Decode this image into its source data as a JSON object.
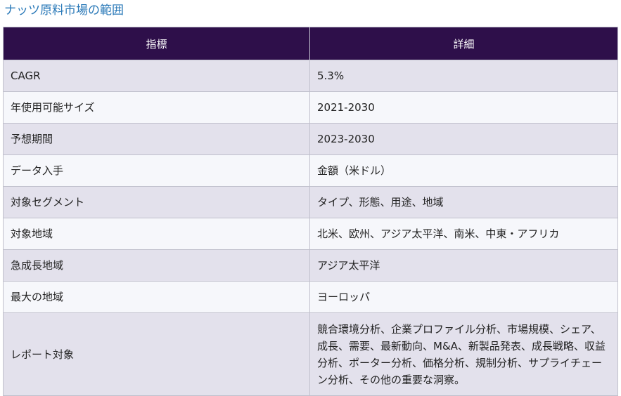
{
  "title": "ナッツ原料市場の範囲",
  "table": {
    "headers": [
      "指標",
      "詳細"
    ],
    "rows": [
      {
        "label": "CAGR",
        "value": "5.3%"
      },
      {
        "label": "年使用可能サイズ",
        "value": "2021-2030"
      },
      {
        "label": "予想期間",
        "value": "2023-2030"
      },
      {
        "label": "データ入手",
        "value": "金額（米ドル）"
      },
      {
        "label": "対象セグメント",
        "value": "タイプ、形態、用途、地域"
      },
      {
        "label": "対象地域",
        "value": "北米、欧州、アジア太平洋、南米、中東・アフリカ"
      },
      {
        "label": "急成長地域",
        "value": "アジア太平洋"
      },
      {
        "label": "最大の地域",
        "value": "ヨーロッパ"
      },
      {
        "label": "レポート対象",
        "value": "競合環境分析、企業プロファイル分析、市場規模、シェア、成長、需要、最新動向、M&A、新製品発表、成長戦略、収益分析、ポーター分析、価格分析、規制分析、サプライチェーン分析、その他の重要な洞察。"
      }
    ]
  }
}
